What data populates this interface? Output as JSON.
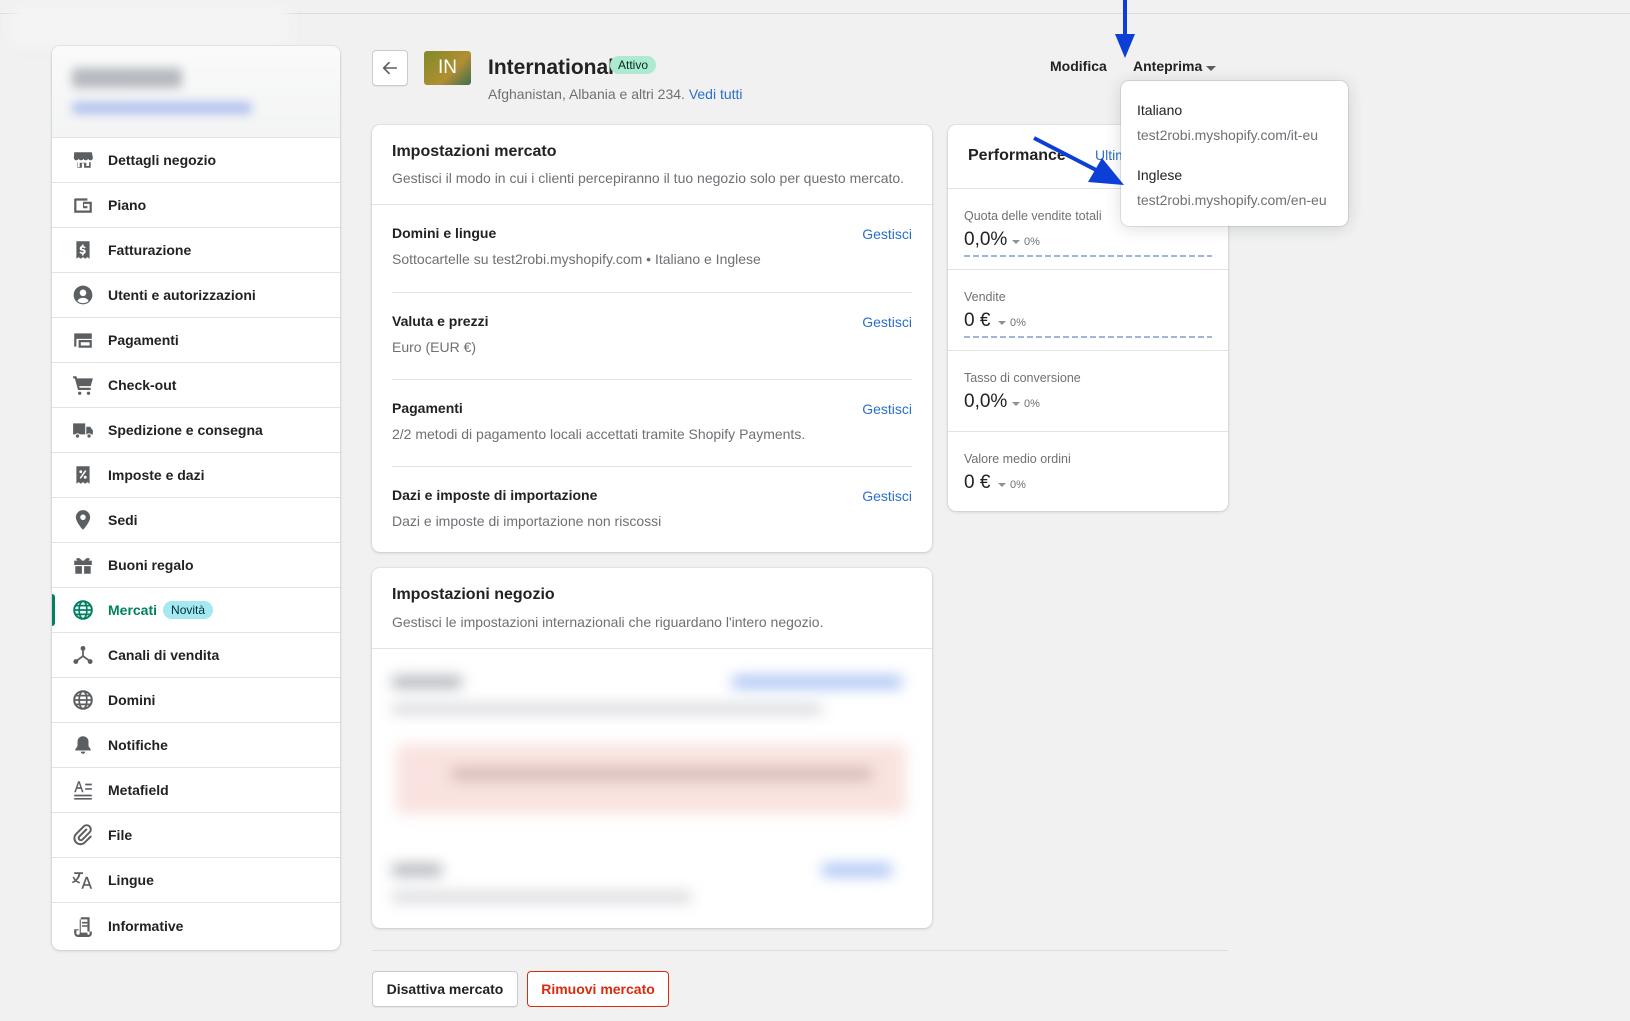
{
  "sidebar": {
    "items": [
      {
        "label": "Dettagli negozio",
        "icon": "store-icon"
      },
      {
        "label": "Piano",
        "icon": "wallet-icon"
      },
      {
        "label": "Fatturazione",
        "icon": "billing-icon"
      },
      {
        "label": "Utenti e autorizzazioni",
        "icon": "user-icon"
      },
      {
        "label": "Pagamenti",
        "icon": "payments-icon"
      },
      {
        "label": "Check-out",
        "icon": "cart-icon"
      },
      {
        "label": "Spedizione e consegna",
        "icon": "truck-icon"
      },
      {
        "label": "Imposte e dazi",
        "icon": "tax-icon"
      },
      {
        "label": "Sedi",
        "icon": "location-icon"
      },
      {
        "label": "Buoni regalo",
        "icon": "gift-icon"
      },
      {
        "label": "Mercati",
        "icon": "globe-icon",
        "badge": "Novità",
        "active": true
      },
      {
        "label": "Canali di vendita",
        "icon": "channels-icon"
      },
      {
        "label": "Domini",
        "icon": "domains-icon"
      },
      {
        "label": "Notifiche",
        "icon": "bell-icon"
      },
      {
        "label": "Metafield",
        "icon": "metafield-icon"
      },
      {
        "label": "File",
        "icon": "paperclip-icon"
      },
      {
        "label": "Lingue",
        "icon": "translate-icon"
      },
      {
        "label": "Informative",
        "icon": "policy-icon"
      }
    ]
  },
  "header": {
    "avatar_text": "IN",
    "title": "International",
    "status": "Attivo",
    "subtitle": "Afghanistan, Albania e altri 234.",
    "view_all": "Vedi tutti",
    "edit_label": "Modifica",
    "preview_label": "Anteprima"
  },
  "preview_menu": {
    "items": [
      {
        "name": "Italiano",
        "url": "test2robi.myshopify.com/it-eu"
      },
      {
        "name": "Inglese",
        "url": "test2robi.myshopify.com/en-eu"
      }
    ]
  },
  "market_settings": {
    "title": "Impostazioni mercato",
    "subtitle": "Gestisci il modo in cui i clienti percepiranno il tuo negozio solo per questo mercato.",
    "sections": [
      {
        "title": "Domini e lingue",
        "desc": "Sottocartelle su test2robi.myshopify.com • Italiano e Inglese",
        "link": "Gestisci"
      },
      {
        "title": "Valuta e prezzi",
        "desc": "Euro (EUR €)",
        "link": "Gestisci"
      },
      {
        "title": "Pagamenti",
        "desc": "2/2 metodi di pagamento locali accettati tramite Shopify Payments.",
        "link": "Gestisci"
      },
      {
        "title": "Dazi e imposte di importazione",
        "desc": "Dazi e imposte di importazione non riscossi",
        "link": "Gestisci"
      }
    ]
  },
  "store_settings": {
    "title": "Impostazioni negozio",
    "subtitle": "Gestisci le impostazioni internazionali che riguardano l'intero negozio."
  },
  "performance": {
    "title": "Performance",
    "range_link": "Ultim",
    "metrics": [
      {
        "label": "Quota delle vendite totali",
        "value": "0,0%",
        "delta": "0%"
      },
      {
        "label": "Vendite",
        "value": "0 €",
        "delta": "0%"
      },
      {
        "label": "Tasso di conversione",
        "value": "0,0%",
        "delta": "0%"
      },
      {
        "label": "Valore medio ordini",
        "value": "0 €",
        "delta": "0%"
      }
    ]
  },
  "footer": {
    "deactivate": "Disattiva mercato",
    "remove": "Rimuovi mercato"
  },
  "colors": {
    "accent": "#008060",
    "link": "#2c6ecb",
    "critical": "#d82c0d",
    "annotation_arrow": "#0b3fd6"
  }
}
